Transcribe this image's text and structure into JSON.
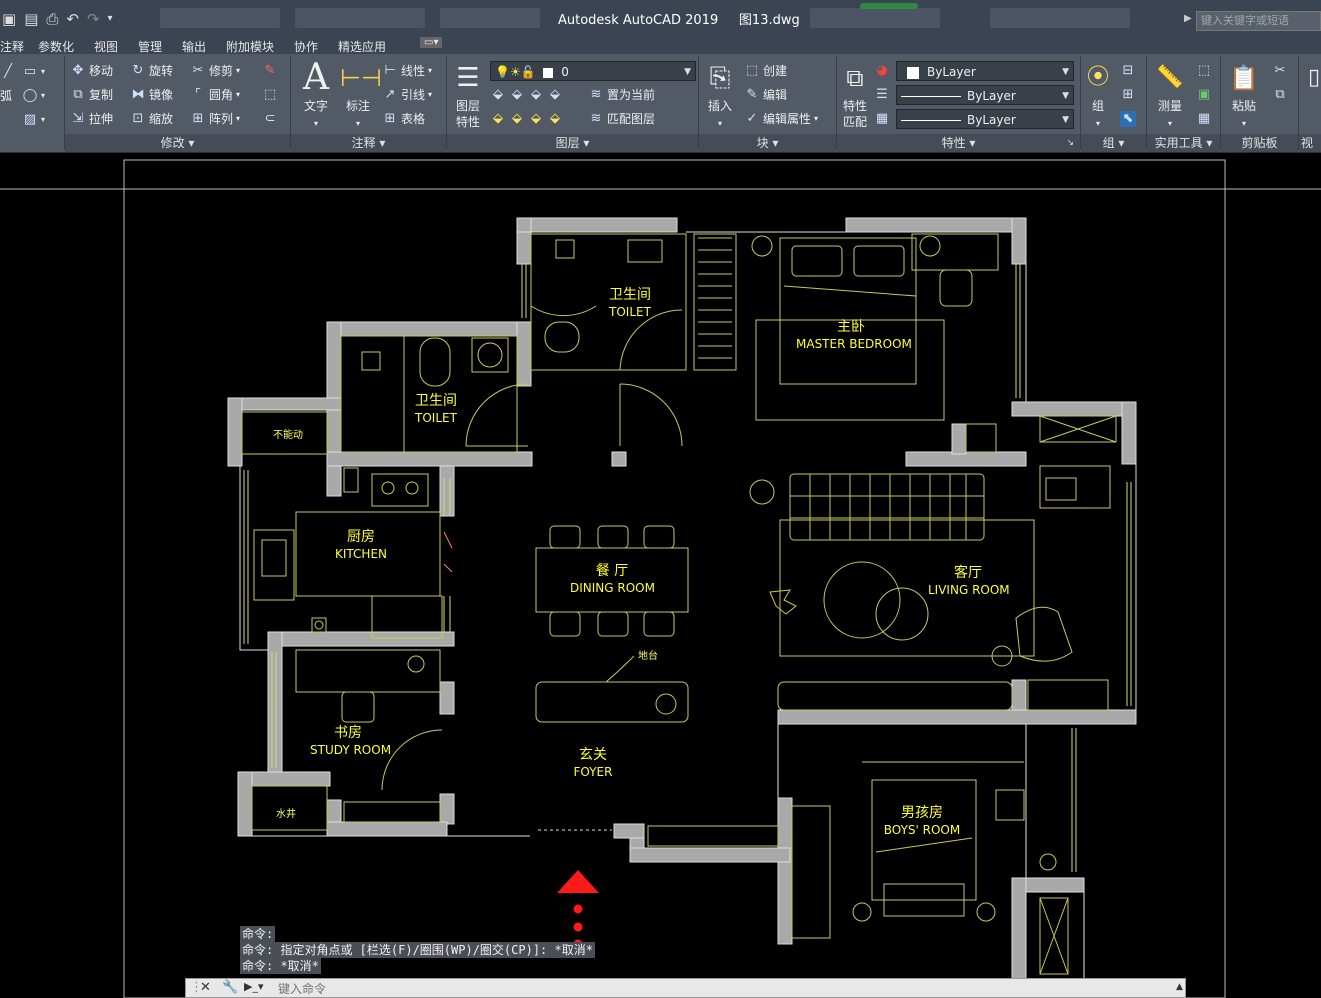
{
  "titlebar": {
    "app_name": "Autodesk AutoCAD 2019",
    "file_name": "图13.dwg",
    "search_placeholder": "键入关键字或短语"
  },
  "menu_tabs": [
    "注释",
    "参数化",
    "视图",
    "管理",
    "输出",
    "附加模块",
    "协作",
    "精选应用"
  ],
  "ribbon": {
    "modify": {
      "footer": "修改",
      "buttons": [
        "移动",
        "旋转",
        "修剪",
        "复制",
        "镜像",
        "圆角",
        "拉伸",
        "缩放",
        "阵列"
      ]
    },
    "annotation": {
      "footer": "注释",
      "text_label": "文字",
      "dimension_label": "标注",
      "buttons": [
        "线性",
        "引线",
        "表格"
      ]
    },
    "layers": {
      "footer": "图层",
      "props_label_1": "图层",
      "props_label_2": "特性",
      "current_layer": "0",
      "set_current": "置为当前",
      "match_layer": "匹配图层"
    },
    "block": {
      "footer": "块",
      "insert_label": "插入",
      "buttons": [
        "创建",
        "编辑",
        "编辑属性"
      ]
    },
    "properties": {
      "footer": "特性",
      "match_label_1": "特性",
      "match_label_2": "匹配",
      "color": "ByLayer",
      "linetype": "ByLayer",
      "lineweight": "ByLayer"
    },
    "group": {
      "footer": "组",
      "label": "组"
    },
    "utilities": {
      "footer": "实用工具",
      "measure_label": "测量"
    },
    "clipboard": {
      "footer": "剪贴板",
      "paste_label": "粘贴"
    },
    "view": {
      "footer": "视图"
    }
  },
  "rooms": {
    "toilet1": {
      "zh": "卫生间",
      "en": "TOILET"
    },
    "master": {
      "zh": "主卧",
      "en": "MASTER BEDROOM"
    },
    "toilet2": {
      "zh": "卫生间",
      "en": "TOILET"
    },
    "nomove": "不能动",
    "kitchen": {
      "zh": "厨房",
      "en": "KITCHEN"
    },
    "dining": {
      "zh": "餐 厅",
      "en": "DINING ROOM"
    },
    "living": {
      "zh": "客厅",
      "en": "LIVING ROOM"
    },
    "floor_drain": "地台",
    "study": {
      "zh": "书房",
      "en": "STUDY ROOM"
    },
    "foyer": {
      "zh": "玄关",
      "en": "FOYER"
    },
    "boys": {
      "zh": "男孩房",
      "en": "BOYS' ROOM"
    },
    "well": "水井"
  },
  "command": {
    "history": [
      "命令:",
      "命令: 指定对角点或 [栏选(F)/圈围(WP)/圈交(CP)]: *取消*",
      "命令: *取消*"
    ],
    "input_placeholder": "键入命令"
  }
}
